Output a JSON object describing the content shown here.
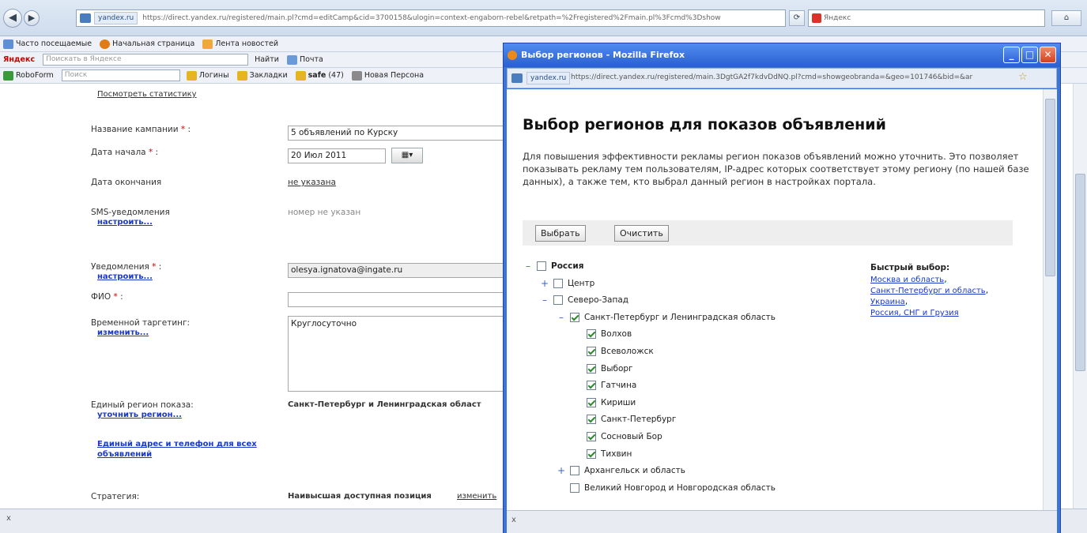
{
  "browser": {
    "site_badge": "yandex.ru",
    "url": "https://direct.yandex.ru/registered/main.pl?cmd=editCamp&cid=3700158&ulogin=context-engaborn-rebel&retpath=%2Fregistered%2Fmain.pl%3Fcmd%3Dshow",
    "search_placeholder": "Яндекс",
    "bookmarks": [
      "Часто посещаемые",
      "Начальная страница",
      "Лента новостей"
    ],
    "yandex_bar": {
      "logo": "Яндекс",
      "search_placeholder": "Поискать в Яндексе",
      "find": "Найти",
      "mail": "Почта"
    },
    "roboform": {
      "name": "RoboForm",
      "search_placeholder": "Поиск",
      "logins": "Логины",
      "bookmarks": "Закладки",
      "safe": "safe",
      "safe_count": "(47)",
      "new_person": "Новая Персона"
    },
    "status": "x"
  },
  "page": {
    "stats_link": "Посмотреть статистику",
    "campaign_name_label": "Название кампании",
    "campaign_name_value": "5 объявлений по Курску",
    "start_date_label": "Дата начала",
    "start_date_value": "20 Июл 2011",
    "end_date_label": "Дата окончания",
    "end_date_value": "не указана",
    "sms_label": "SMS-уведомления",
    "sms_link": "настроить...",
    "sms_value": "номер не указан",
    "notifications_label": "Уведомления",
    "notifications_link": "настроить...",
    "notifications_value": "olesya.ignatova@ingate.ru",
    "fio_label": "ФИО",
    "fio_value": "",
    "time_targeting_label": "Временной таргетинг:",
    "time_targeting_link": "изменить...",
    "time_targeting_value": "Круглосуточно",
    "region_label": "Единый регион показа:",
    "region_link": "уточнить регион...",
    "region_value": "Санкт-Петербург и Ленинградская област",
    "address_link": "Единый адрес и телефон для всех объявлений",
    "strategy_label": "Стратегия:",
    "strategy_value": "Наивысшая доступная позиция",
    "strategy_link": "изменить",
    "required_mark": "*",
    "colon": ":"
  },
  "popup": {
    "window_title": "Выбор регионов - Mozilla Firefox",
    "site_badge": "yandex.ru",
    "url": "https://direct.yandex.ru/registered/main.3DgtGA2f7kdvDdNQ.pl?cmd=showgeobranda=&geo=101746&bid=&ar",
    "heading": "Выбор регионов для показов объявлений",
    "description": "Для повышения эффективности рекламы регион показов объявлений можно уточнить. Это позволяет показывать рекламу тем пользователям, IP-адрес которых соответствует этому региону (по нашей базе данных), а также тем, кто выбрал данный регион в настройках портала.",
    "select_button": "Выбрать",
    "clear_button": "Очистить",
    "quick_title": "Быстрый выбор:",
    "quick_links": [
      "Москва и область",
      "Санкт-Петербург и область",
      "Украина",
      "Россия, СНГ и Грузия"
    ],
    "tree": [
      {
        "label": "Россия",
        "expander": "–",
        "checked": false,
        "bold": true,
        "indent": 0
      },
      {
        "label": "Центр",
        "expander": "+",
        "checked": false,
        "bold": false,
        "indent": 1
      },
      {
        "label": "Северо-Запад",
        "expander": "–",
        "checked": false,
        "bold": false,
        "indent": 1
      },
      {
        "label": "Санкт-Петербург и Ленинградская область",
        "expander": "–",
        "checked": true,
        "bold": false,
        "indent": 2
      },
      {
        "label": "Волхов",
        "expander": "",
        "checked": true,
        "bold": false,
        "indent": 3
      },
      {
        "label": "Всеволожск",
        "expander": "",
        "checked": true,
        "bold": false,
        "indent": 3
      },
      {
        "label": "Выборг",
        "expander": "",
        "checked": true,
        "bold": false,
        "indent": 3
      },
      {
        "label": "Гатчина",
        "expander": "",
        "checked": true,
        "bold": false,
        "indent": 3
      },
      {
        "label": "Кириши",
        "expander": "",
        "checked": true,
        "bold": false,
        "indent": 3
      },
      {
        "label": "Санкт-Петербург",
        "expander": "",
        "checked": true,
        "bold": false,
        "indent": 3
      },
      {
        "label": "Сосновый Бор",
        "expander": "",
        "checked": true,
        "bold": false,
        "indent": 3
      },
      {
        "label": "Тихвин",
        "expander": "",
        "checked": true,
        "bold": false,
        "indent": 3
      },
      {
        "label": "Архангельск и область",
        "expander": "+",
        "checked": false,
        "bold": false,
        "indent": 2
      },
      {
        "label": "Великий Новгород и Новгородская область",
        "expander": "",
        "checked": false,
        "bold": false,
        "indent": 2
      }
    ],
    "status": "x"
  },
  "colors": {
    "link": "#1a38c9",
    "window_frame": "#3d74d8",
    "checkmark": "#2d8a2d",
    "required": "#cc0000"
  }
}
